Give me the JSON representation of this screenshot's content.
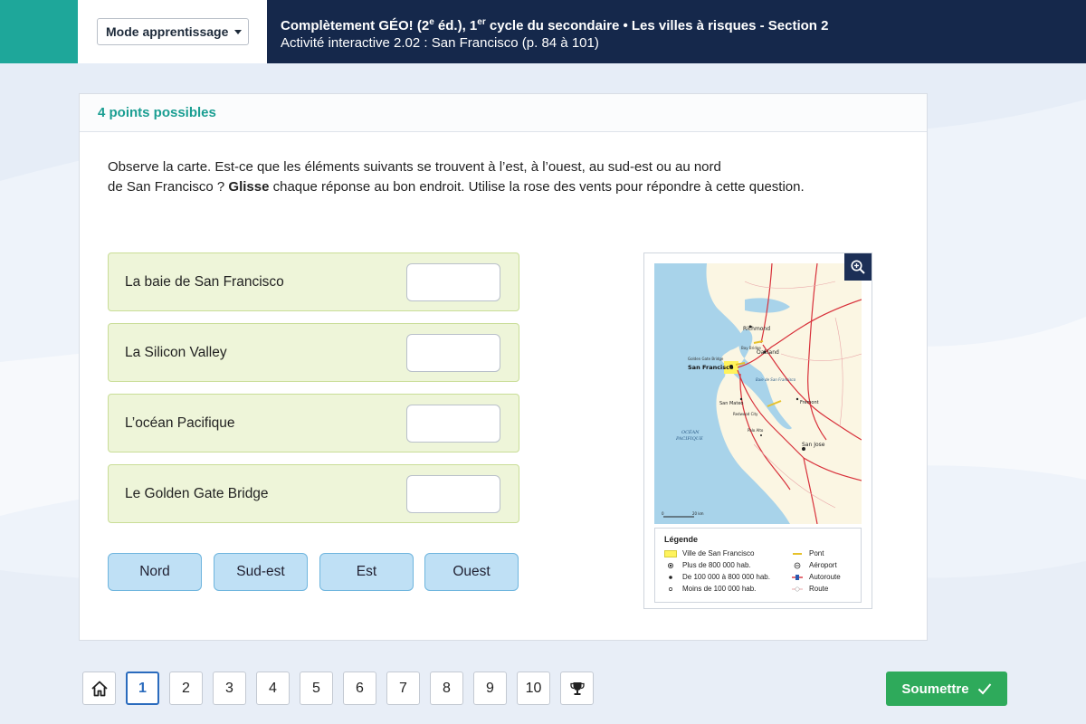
{
  "header": {
    "mode_label": "Mode apprentissage",
    "title_part1": "Complètement GÉO! (2",
    "title_sup1": "e",
    "title_part2": " éd.), 1",
    "title_sup2": "er",
    "title_part3": " cycle du secondaire • Les villes à risques - Section 2",
    "subtitle": "Activité interactive 2.02 : San Francisco (p. 84 à 101)"
  },
  "card": {
    "points": "4 points possibles",
    "instr_line1": "Observe la carte. Est-ce que les éléments suivants se trouvent à l’est, à l’ouest, au sud-est ou au nord",
    "instr_line2_a": "de San Francisco ? ",
    "instr_line2_bold": "Glisse",
    "instr_line2_b": " chaque réponse au bon endroit. Utilise la rose des vents pour répondre à cette question."
  },
  "drop_rows": [
    {
      "label": "La baie de San Francisco"
    },
    {
      "label": "La Silicon Valley"
    },
    {
      "label": "L’océan Pacifique"
    },
    {
      "label": "Le Golden Gate Bridge"
    }
  ],
  "chips": [
    {
      "label": "Nord"
    },
    {
      "label": "Sud-est"
    },
    {
      "label": "Est"
    },
    {
      "label": "Ouest"
    }
  ],
  "map": {
    "zoom_icon": "zoom-in-icon",
    "labels": {
      "richmond": "Richmond",
      "oakland": "Oakland",
      "golden_gate": "Golden Gate Bridge",
      "bay_bridge": "Bay Bridge",
      "san_francisco": "San Francisco",
      "baie": "Baie de San Francisco",
      "san_mateo": "San Mateo",
      "fremont": "Fremont",
      "redwood": "Redwood City",
      "palo_alto": "Palo Alto",
      "san_jose": "San Jose",
      "ocean1": "OCÉAN",
      "ocean2": "PACIFIQUE",
      "scale_label": "20 km",
      "scale_zero": "0"
    },
    "legend": {
      "title": "Légende",
      "items": [
        "Ville de San Francisco",
        "Plus de 800 000 hab.",
        "De 100 000 à 800 000 hab.",
        "Moins de 100 000 hab.",
        "Pont",
        "Aéroport",
        "Autoroute",
        "Route"
      ]
    },
    "colors": {
      "water": "#a8d3ea",
      "land": "#fbf6e3",
      "city": "#fff35c",
      "highway": "#d8303a"
    }
  },
  "pagination": {
    "home_icon": "home-icon",
    "pages": [
      "1",
      "2",
      "3",
      "4",
      "5",
      "6",
      "7",
      "8",
      "9",
      "10"
    ],
    "active_page": "1",
    "trophy_icon": "trophy-icon"
  },
  "submit": {
    "label": "Soumettre",
    "icon": "check-icon"
  }
}
